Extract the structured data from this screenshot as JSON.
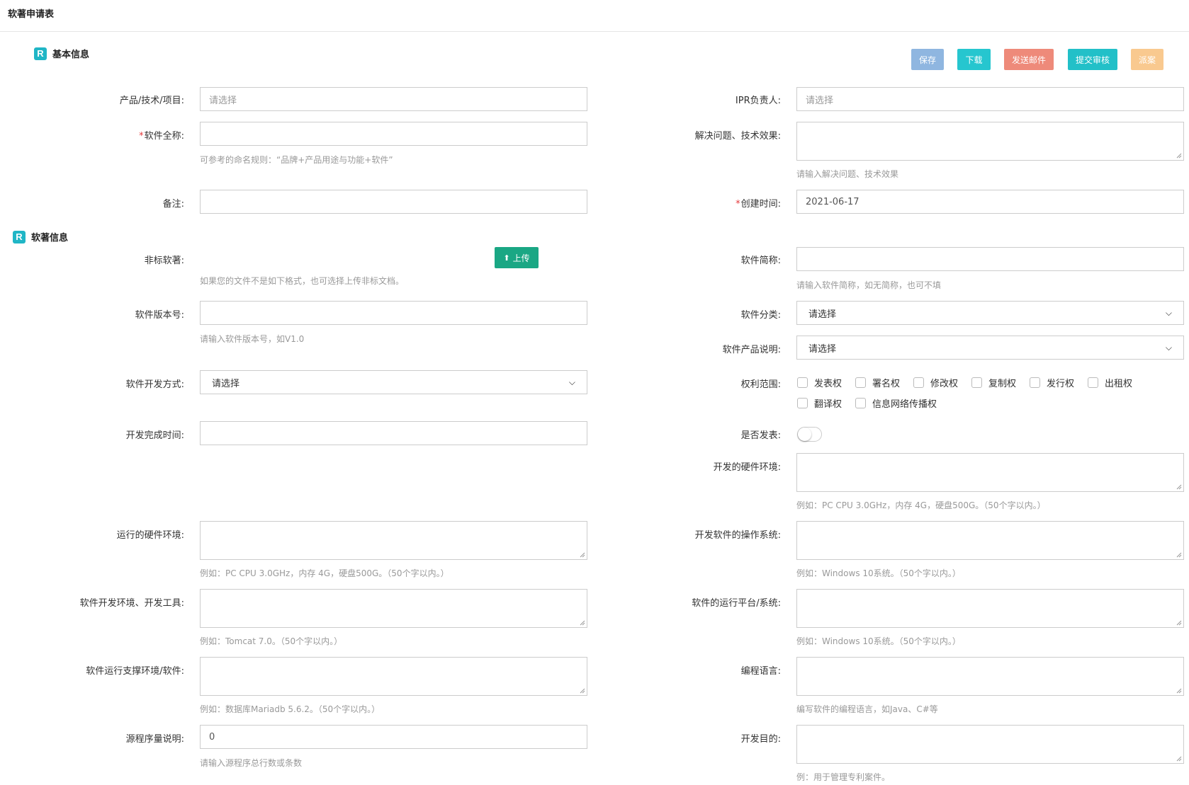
{
  "page": {
    "title": "软著申请表"
  },
  "sections": {
    "basic": "基本信息",
    "software": "软著信息"
  },
  "section_icon_letter": "R",
  "toolbar": {
    "buttons": [
      {
        "label": "保存",
        "color": "#8fb6e0"
      },
      {
        "label": "下载",
        "color": "#26c6cf"
      },
      {
        "label": "发送邮件",
        "color": "#ee8a7a"
      },
      {
        "label": "提交审核",
        "color": "#22c0c8"
      },
      {
        "label": "派案",
        "color": "#f9c98f"
      }
    ]
  },
  "form": {
    "product": {
      "label": "产品/技术/项目:",
      "placeholder": "请选择"
    },
    "ipr_owner": {
      "label": "IPR负责人:",
      "placeholder": "请选择"
    },
    "full_name": {
      "label": "软件全称:",
      "required_mark": "*",
      "hint": "可参考的命名规则：“品牌+产品用途与功能+软件”"
    },
    "problem_effect": {
      "label": "解决问题、技术效果:",
      "hint": "请输入解决问题、技术效果"
    },
    "remark": {
      "label": "备注:"
    },
    "created_time": {
      "label": "创建时间:",
      "required_mark": "*",
      "value": "2021-06-17"
    },
    "nonstandard": {
      "label": "非标软著:",
      "upload_label": "上传",
      "hint": "如果您的文件不是如下格式，也可选择上传非标文档。"
    },
    "short_name": {
      "label": "软件简称:",
      "hint": "请输入软件简称，如无简称，也可不填"
    },
    "version": {
      "label": "软件版本号:",
      "hint": "请输入软件版本号，如V1.0"
    },
    "category": {
      "label": "软件分类:",
      "selected": "请选择"
    },
    "product_desc": {
      "label": "软件产品说明:",
      "selected": "请选择"
    },
    "dev_method": {
      "label": "软件开发方式:",
      "selected": "请选择"
    },
    "rights": {
      "label": "权利范围:",
      "options": [
        "发表权",
        "署名权",
        "修改权",
        "复制权",
        "发行权",
        "出租权",
        "翻译权",
        "信息网络传播权"
      ]
    },
    "finish_time": {
      "label": "开发完成时间:"
    },
    "published": {
      "label": "是否发表:",
      "on": false
    },
    "dev_hardware": {
      "label": "开发的硬件环境:",
      "hint": "例如：PC CPU 3.0GHz，内存 4G，硬盘500G。（50个字以内。）"
    },
    "run_hardware": {
      "label": "运行的硬件环境:",
      "hint": "例如：PC CPU 3.0GHz，内存 4G，硬盘500G。（50个字以内。）"
    },
    "dev_os": {
      "label": "开发软件的操作系统:",
      "hint": "例如：Windows 10系统。（50个字以内。）"
    },
    "dev_tools": {
      "label": "软件开发环境、开发工具:",
      "hint": "例如：Tomcat 7.0。（50个字以内。）"
    },
    "run_platform": {
      "label": "软件的运行平台/系统:",
      "hint": "例如：Windows 10系统。（50个字以内。）"
    },
    "support_env": {
      "label": "软件运行支撑环境/软件:",
      "hint": "例如：数据库Mariadb 5.6.2。（50个字以内。）"
    },
    "language": {
      "label": "编程语言:",
      "hint": "编写软件的编程语言，如Java、C#等"
    },
    "source_lines": {
      "label": "源程序量说明:",
      "value": "0",
      "hint": "请输入源程序总行数或条数"
    },
    "purpose": {
      "label": "开发目的:",
      "hint": "例：用于管理专利案件。"
    }
  }
}
